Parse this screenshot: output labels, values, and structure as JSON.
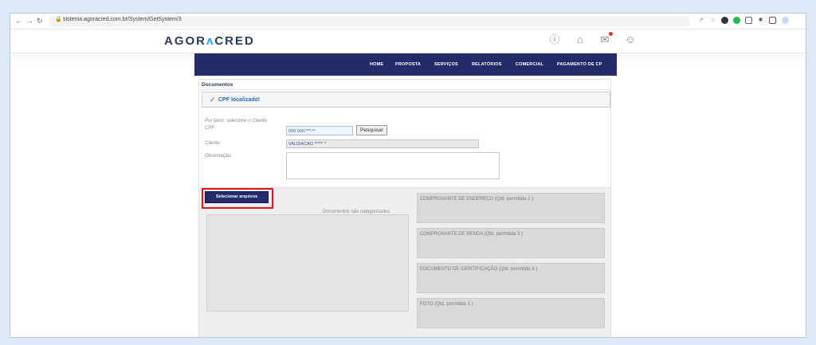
{
  "browser": {
    "url": "sistema.agoracred.com.br/System/GetSystem/3",
    "nav_icons": [
      "back-arrow-icon",
      "forward-arrow-icon",
      "reload-icon"
    ]
  },
  "site": {
    "logo_part1": "AGOR",
    "logo_accent": "ʌ",
    "logo_part2": "CRED",
    "header_icons": [
      "help-icon",
      "home-icon",
      "mail-icon",
      "user-icon"
    ]
  },
  "nav": {
    "items": [
      "HOME",
      "PROPOSTA",
      "SERVIÇOS",
      "RELATÓRIOS",
      "COMERCIAL",
      "PAGAMENTO DE CP"
    ]
  },
  "documents": {
    "title": "Documentos",
    "alert_text": "CPF localizado!",
    "hint": "Por favor, selecione o Cliente",
    "cpf_label": "CPF:",
    "cpf_value": "000.000.***-**",
    "search_label": "Pesquisar",
    "cliente_label": "Cliente:",
    "cliente_value": "VALIDACAO ***** *",
    "obs_label": "Observação:",
    "select_files_label": "Selecionar arquivos",
    "uncategorized_label": "Documentos não categorizados",
    "categories": [
      "COMPROVANTE DE ENDEREÇO (Qtd. permitida 2 )",
      "COMPROVANTE DE RENDA (Qtd. permitida 3 )",
      "DOCUMENTO DE IDENTIFICAÇÃO (Qtd. permitida 3 )",
      "FOTO (Qtd. permitida 1 )"
    ]
  },
  "colors": {
    "nav_bg": "#232c69",
    "highlight_border": "#e3151b",
    "alert_text": "#2a6bb8"
  }
}
